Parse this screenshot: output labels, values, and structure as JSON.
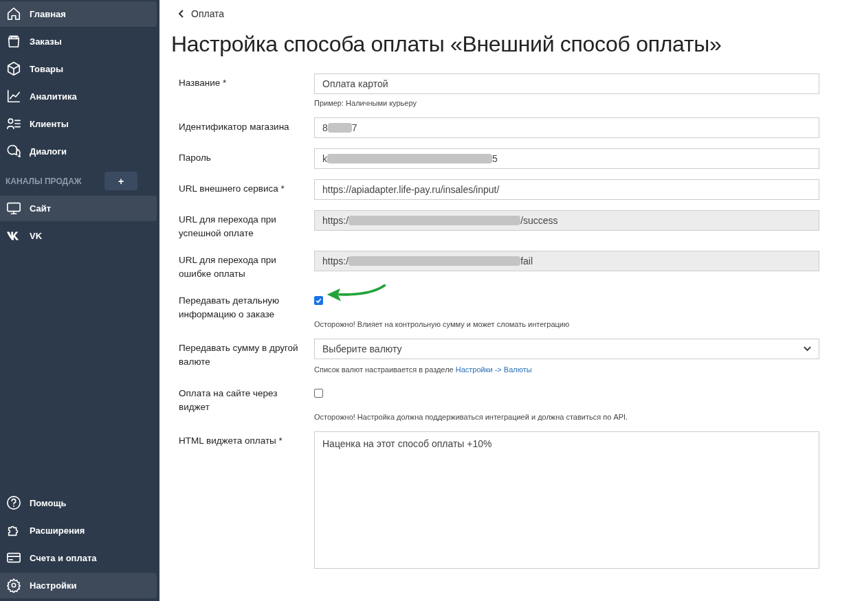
{
  "sidebar": {
    "items": [
      {
        "label": "Главная",
        "selected": true
      },
      {
        "label": "Заказы",
        "selected": false
      },
      {
        "label": "Товары",
        "selected": false
      },
      {
        "label": "Аналитика",
        "selected": false
      },
      {
        "label": "Клиенты",
        "selected": false
      },
      {
        "label": "Диалоги",
        "selected": false
      }
    ],
    "channels_heading": "КАНАЛЫ ПРОДАЖ",
    "add_button": "+",
    "channels": [
      {
        "label": "Сайт",
        "selected": true
      },
      {
        "label": "VK",
        "selected": false
      }
    ],
    "bottom_items": [
      {
        "label": "Помощь",
        "selected": false
      },
      {
        "label": "Расширения",
        "selected": false
      },
      {
        "label": "Счета и оплата",
        "selected": false
      },
      {
        "label": "Настройки",
        "selected": true
      }
    ]
  },
  "breadcrumb": "Оплата",
  "title": "Настройка способа оплаты «Внешний способ оплаты»",
  "fields": [
    {
      "kind": "text",
      "label": "Название *",
      "value": "Оплата картой",
      "disabled": false,
      "hint": "Пример: Наличными курьеру"
    },
    {
      "kind": "redacted",
      "label": "Идентификатор магазина",
      "value_start": "8",
      "value_end": "7",
      "disabled": false
    },
    {
      "kind": "redacted",
      "label": "Пароль",
      "value_start": "k",
      "value_end": "5",
      "disabled": false
    },
    {
      "kind": "text",
      "label": "URL внешнего сервиса *",
      "value": "https://apiadapter.life-pay.ru/insales/input/",
      "disabled": false
    },
    {
      "kind": "redacted",
      "label": "URL для перехода при успешной оплате",
      "value_start": "https:/",
      "value_end": "/success",
      "disabled": true
    },
    {
      "kind": "redacted",
      "label": "URL для перехода при ошибке оплаты",
      "value_start": "https:/",
      "value_end": "fail",
      "disabled": true
    },
    {
      "kind": "checkbox",
      "label": "Передавать детальную информацию о заказе",
      "checked": true,
      "pointer_arrow": true,
      "hint": "Осторожно! Влияет на контрольную сумму и может сломать интеграцию"
    },
    {
      "kind": "select",
      "label": "Передавать сумму в другой валюте",
      "value": "Выберите валюту",
      "hint": "Список валют настраивается в разделе ",
      "hint_link": "Настройки -> Валюты"
    },
    {
      "kind": "checkbox",
      "label": "Оплата на сайте через виджет",
      "checked": false,
      "hint": "Осторожно! Настройка должна поддерживаться интеграцией и должна ставиться по API."
    },
    {
      "kind": "textarea",
      "label": "HTML виджета оплаты *",
      "value": "Наценка на этот способ оплаты +10%"
    }
  ]
}
